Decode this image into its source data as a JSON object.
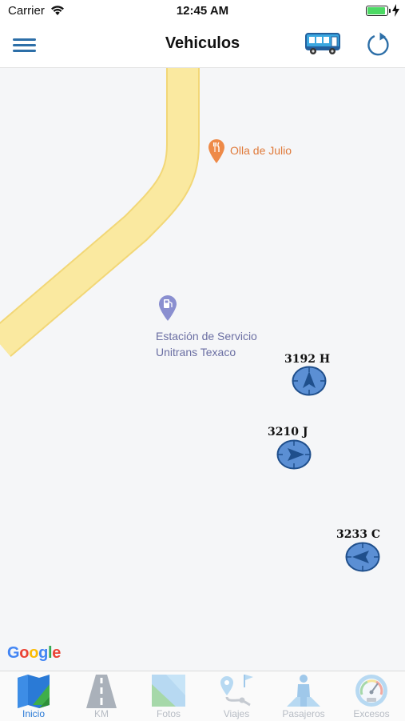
{
  "status_bar": {
    "carrier": "Carrier",
    "time": "12:45 AM",
    "battery_level": 1.0
  },
  "nav": {
    "title": "Vehiculos",
    "menu_icon": "hamburger-menu-icon",
    "bus_icon": "bus-icon",
    "refresh_icon": "refresh-icon"
  },
  "map": {
    "pois": [
      {
        "name": "Olla de Julio",
        "type": "restaurant",
        "color": "#e07a3a"
      },
      {
        "name_line1": "Estación de Servicio",
        "name_line2": "Unitrans Texaco",
        "type": "gas-station",
        "color": "#6b6fa3"
      }
    ],
    "vehicles": [
      {
        "label": "3192  H",
        "heading": "north"
      },
      {
        "label": "3210 J",
        "heading": "east"
      },
      {
        "label": "3233 C",
        "heading": "west"
      }
    ],
    "attribution": "Google"
  },
  "tabs": [
    {
      "label": "Inicio",
      "icon": "map-icon",
      "active": true
    },
    {
      "label": "KM",
      "icon": "road-icon",
      "active": false
    },
    {
      "label": "Fotos",
      "icon": "photos-icon",
      "active": false
    },
    {
      "label": "Viajes",
      "icon": "route-icon",
      "active": false
    },
    {
      "label": "Pasajeros",
      "icon": "passenger-icon",
      "active": false
    },
    {
      "label": "Excesos",
      "icon": "speedometer-icon",
      "active": false
    }
  ],
  "colors": {
    "accent": "#2a7ad6",
    "nav_icon": "#2d6fa8",
    "road": "#fae9a0",
    "road_border": "#f2d777",
    "map_bg": "#f5f6f8",
    "vehicle_marker": "#5b8fd4"
  }
}
